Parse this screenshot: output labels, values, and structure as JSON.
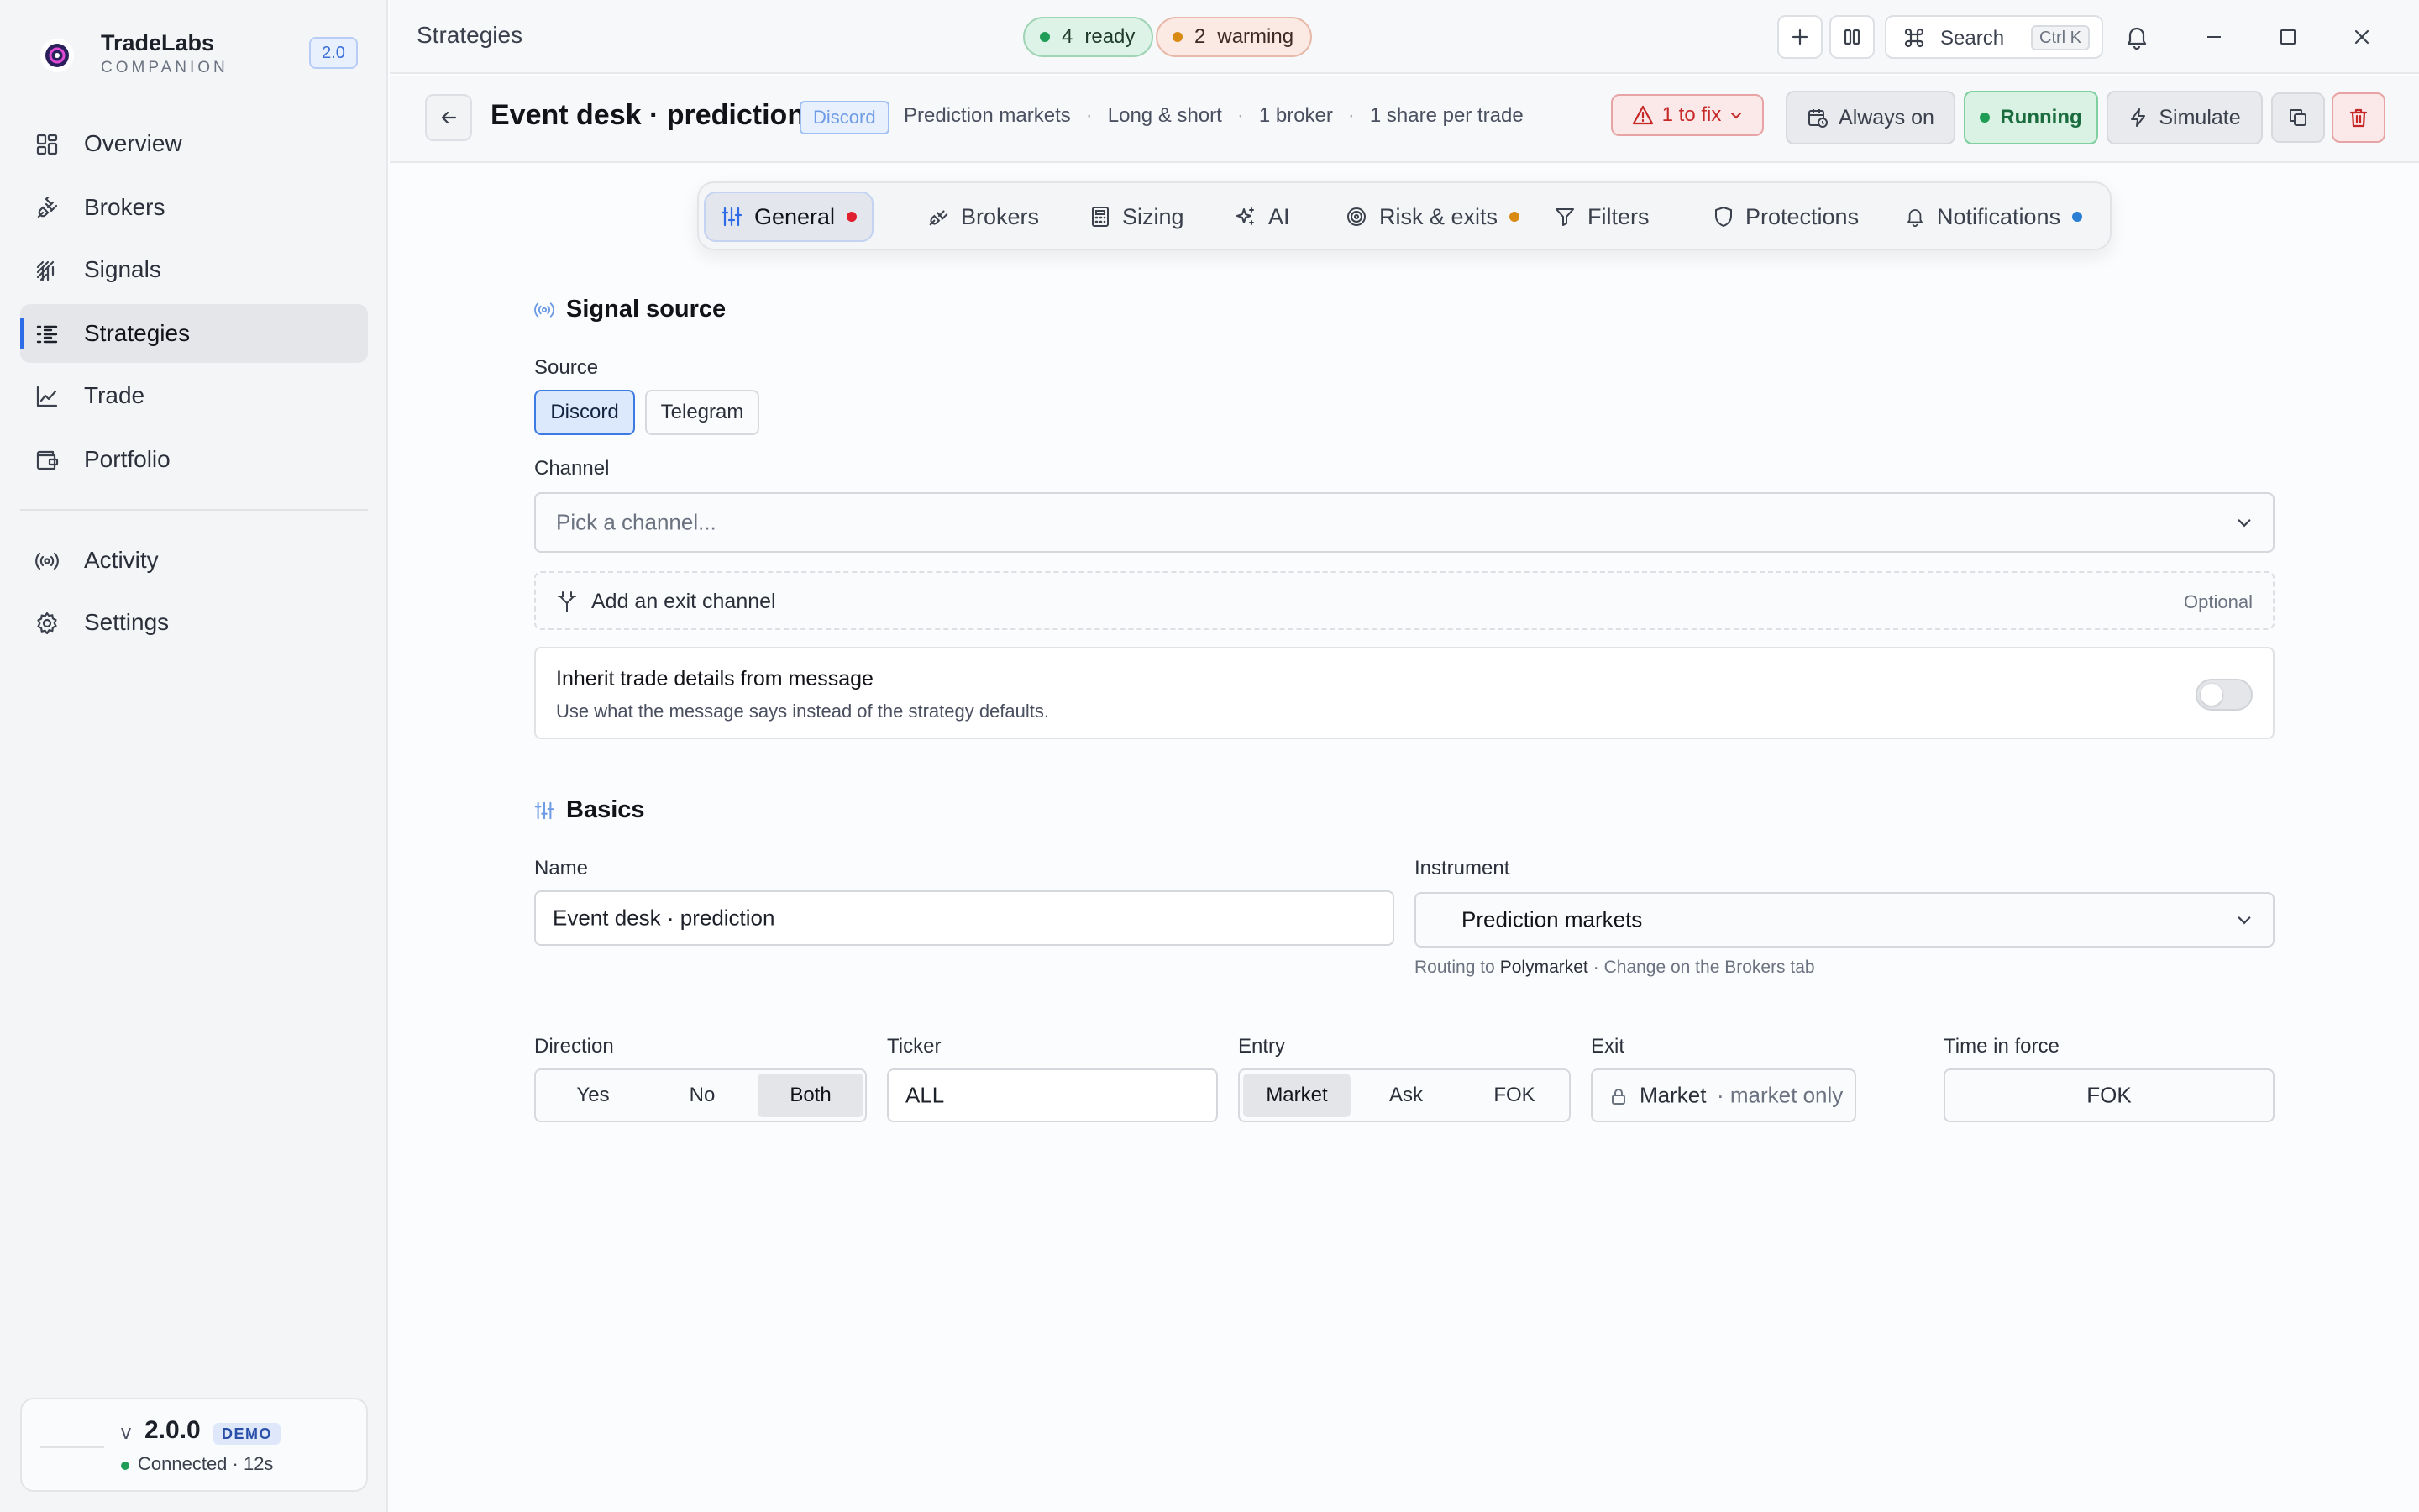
{
  "app": {
    "name": "TradeLabs",
    "subtitle": "COMPANION",
    "version_badge": "2.0"
  },
  "sidebar": {
    "items": [
      {
        "label": "Overview",
        "icon": "grid-icon"
      },
      {
        "label": "Brokers",
        "icon": "plug-icon"
      },
      {
        "label": "Signals",
        "icon": "signal-icon"
      },
      {
        "label": "Strategies",
        "icon": "list-icon",
        "active": true
      },
      {
        "label": "Trade",
        "icon": "chart-icon"
      },
      {
        "label": "Portfolio",
        "icon": "wallet-icon"
      },
      {
        "label": "Activity",
        "icon": "broadcast-icon"
      },
      {
        "label": "Settings",
        "icon": "gear-icon"
      }
    ],
    "version_card": {
      "v": "v",
      "version": "2.0.0",
      "badge": "DEMO",
      "status": "Connected · 12s"
    }
  },
  "titlebar": {
    "title": "Strategies",
    "ready_count": "4",
    "ready_label": "ready",
    "warming_count": "2",
    "warming_label": "warming",
    "search_label": "Search",
    "search_shortcut": "Ctrl K"
  },
  "header": {
    "title": "Event desk · prediction",
    "source_tag": "Discord",
    "meta": [
      "Prediction markets",
      "Long & short",
      "1 broker",
      "1 share per trade"
    ],
    "fix_label": "1 to fix",
    "schedule_label": "Always on",
    "status_label": "Running",
    "simulate_label": "Simulate"
  },
  "tabs": [
    {
      "label": "General",
      "active": true,
      "dot": "#e0202e"
    },
    {
      "label": "Brokers"
    },
    {
      "label": "Sizing"
    },
    {
      "label": "AI"
    },
    {
      "label": "Risk & exits",
      "dot": "#d98a12"
    },
    {
      "label": "Filters"
    },
    {
      "label": "Protections"
    },
    {
      "label": "Notifications",
      "dot": "#2a7fd4"
    }
  ],
  "signal_source": {
    "heading": "Signal source",
    "source_label": "Source",
    "sources": [
      "Discord",
      "Telegram"
    ],
    "selected_source": "Discord",
    "channel_label": "Channel",
    "channel_placeholder": "Pick a channel...",
    "exit_channel_label": "Add an exit channel",
    "exit_channel_optional": "Optional",
    "inherit_title": "Inherit trade details from message",
    "inherit_desc": "Use what the message says instead of the strategy defaults.",
    "inherit_enabled": false
  },
  "basics": {
    "heading": "Basics",
    "name_label": "Name",
    "name_value": "Event desk · prediction",
    "instrument_label": "Instrument",
    "instrument_value": "Prediction markets",
    "routing_prefix": "Routing to",
    "routing_broker": "Polymarket",
    "routing_suffix": "· Change on the Brokers tab",
    "direction_label": "Direction",
    "direction_options": [
      "Yes",
      "No",
      "Both"
    ],
    "direction_selected": "Both",
    "ticker_label": "Ticker",
    "ticker_value": "ALL",
    "entry_label": "Entry",
    "entry_options": [
      "Market",
      "Ask",
      "FOK"
    ],
    "entry_selected": "Market",
    "exit_label": "Exit",
    "exit_value": "Market",
    "exit_note": "· market only",
    "tif_label": "Time in force",
    "tif_value": "FOK"
  },
  "colors": {
    "accent": "#2e6be6",
    "success": "#1f9d57",
    "danger": "#c62828",
    "warning": "#d98a12"
  }
}
